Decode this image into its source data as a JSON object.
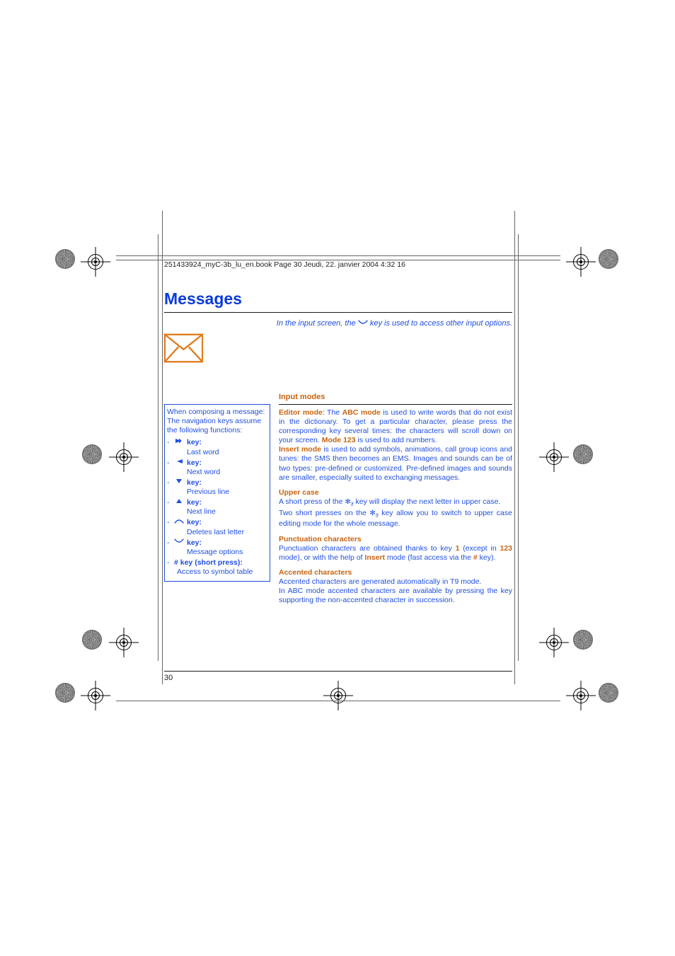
{
  "header": {
    "file_line": "251433924_myC-3b_lu_en.book  Page 30  Jeudi, 22. janvier 2004  4:32 16"
  },
  "chapter_title": "Messages",
  "intro": {
    "pre": "In the input screen, the ",
    "post": " key is used to access other input options."
  },
  "sidebar": {
    "intro": "When composing a message: The navigation keys assume the following functions:",
    "items": [
      {
        "icon": "right",
        "label": "key:",
        "desc": "Last word"
      },
      {
        "icon": "left",
        "label": "key:",
        "desc": "Next word"
      },
      {
        "icon": "down",
        "label": "key:",
        "desc": "Previous line"
      },
      {
        "icon": "up",
        "label": "key:",
        "desc": "Next line"
      },
      {
        "icon": "ok",
        "label": "key:",
        "desc": "Deletes last letter"
      },
      {
        "icon": "cancel",
        "label": "key:",
        "desc": "Message options"
      },
      {
        "icon": "none",
        "label": "# key (short press):",
        "desc": "Access to symbol table"
      }
    ]
  },
  "main": {
    "h_input_modes": "Input modes",
    "editor_p1_a": "Editor mode",
    "editor_p1_b": ": The ",
    "editor_p1_c": "ABC mode",
    "editor_p1_d": " is used to write words that do not exist in the dictionary. To get a particular character, please press the corresponding key several times: the characters will scroll down on your screen. ",
    "editor_p1_e": "Mode 123",
    "editor_p1_f": " is used to add numbers.",
    "insert_p_a": "Insert mode",
    "insert_p_b": " is used to add symbols, animations, call group icons and tunes: the SMS then becomes an EMS. Images and sounds can be of two types: pre-defined or customized. Pre-defined images and sounds are smaller, especially suited to exchanging messages.",
    "h_upper": "Upper case",
    "upper_p1_a": "A short press of the ",
    "upper_p1_b": " key will display the next letter in upper case.",
    "upper_p2_a": "Two short presses on the ",
    "upper_p2_b": " key allow you to switch to upper case editing mode for the whole message.",
    "h_punct": "Punctuation characters",
    "punct_a": "Punctuation characters are obtained thanks to key ",
    "punct_b": "1",
    "punct_c": " (except in ",
    "punct_d": "123",
    "punct_e": " mode), or with the help of ",
    "punct_f": "Insert",
    "punct_g": " mode (fast access via the ",
    "punct_h": "#",
    "punct_i": " key).",
    "h_accent": "Accented characters",
    "accent_p1": "Accented characters are generated automatically in T9 mode.",
    "accent_p2": "In ABC mode accented characters are available by pressing the key supporting the non-accented character in succession."
  },
  "page_number": "30",
  "icon_labels": {
    "right": "nav-right-icon",
    "left": "nav-left-icon",
    "down": "nav-down-icon",
    "up": "nav-up-icon",
    "ok": "ok-key-icon",
    "cancel": "cancel-key-icon"
  }
}
